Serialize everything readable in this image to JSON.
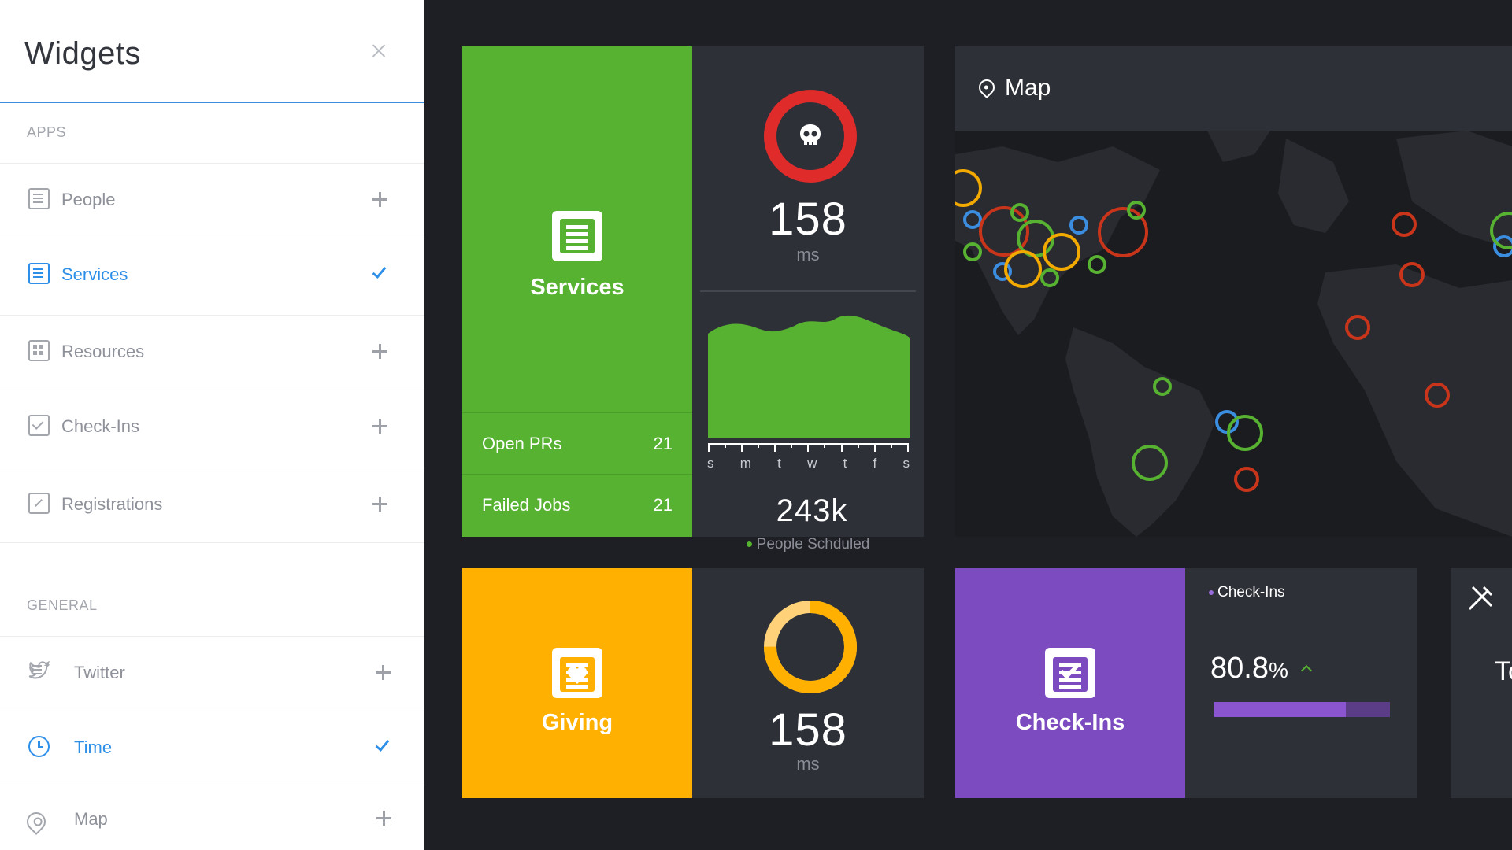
{
  "sidebar": {
    "title": "Widgets",
    "sections": {
      "apps": "APPS",
      "general": "GENERAL"
    },
    "items": [
      {
        "label": "People",
        "icon": "people-icon",
        "state": "add"
      },
      {
        "label": "Services",
        "icon": "services-icon",
        "state": "selected"
      },
      {
        "label": "Resources",
        "icon": "resources-icon",
        "state": "add"
      },
      {
        "label": "Check-Ins",
        "icon": "check-ins-icon",
        "state": "add"
      },
      {
        "label": "Registrations",
        "icon": "registrations-icon",
        "state": "add"
      },
      {
        "label": "Twitter",
        "icon": "twitter-icon",
        "state": "add"
      },
      {
        "label": "Time",
        "icon": "clock-icon",
        "state": "selected"
      },
      {
        "label": "Map",
        "icon": "map-pin-icon",
        "state": "add"
      }
    ]
  },
  "services": {
    "title": "Services",
    "color": "#56b230",
    "stats": [
      {
        "label": "Open PRs",
        "value": "21"
      },
      {
        "label": "Failed Jobs",
        "value": "21"
      }
    ],
    "response": {
      "value": "158",
      "unit": "ms",
      "ring_color": "#e02b2b"
    },
    "chart_days": [
      "s",
      "m",
      "t",
      "w",
      "t",
      "f",
      "s"
    ],
    "people": {
      "value": "243k",
      "label": "People Schduled"
    }
  },
  "map": {
    "title": "Map"
  },
  "giving": {
    "title": "Giving",
    "color": "#ffb000",
    "response": {
      "value": "158",
      "unit": "ms",
      "ring_fraction": 0.75
    }
  },
  "checkins": {
    "title": "Check-Ins",
    "color": "#7c4bbf",
    "legend": "Check-Ins",
    "percent": "80.8",
    "percent_sign": "%",
    "progress": 0.75
  },
  "partial": {
    "text": "To"
  }
}
